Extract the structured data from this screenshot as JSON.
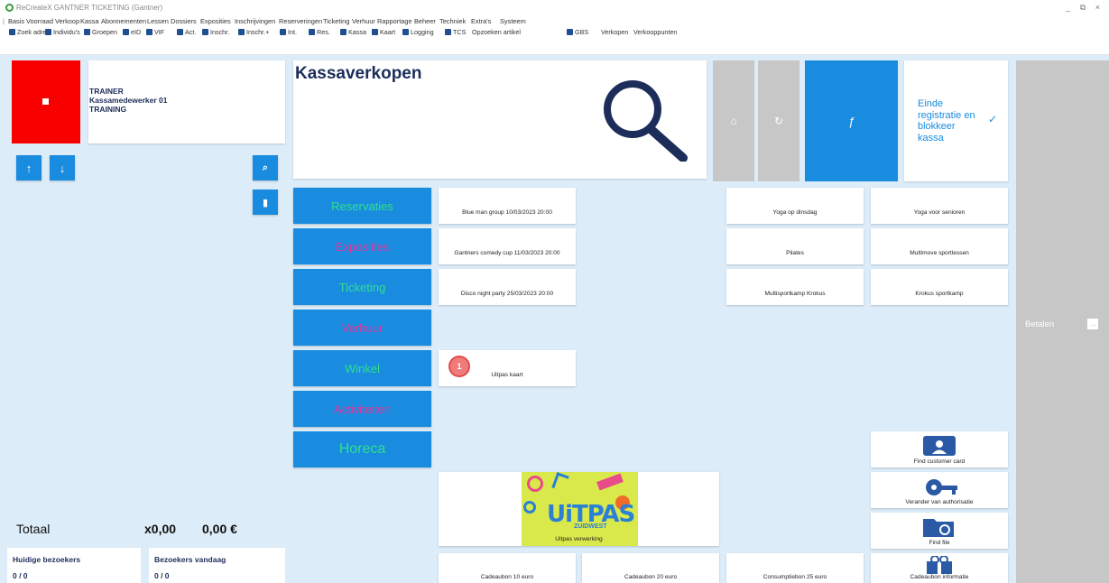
{
  "window": {
    "title": "ReCreateX GANTNER TICKETING (Gantner)",
    "controls": "_ ⧉ ×"
  },
  "menu": [
    "Basis",
    "Voorraad",
    "Verkoop",
    "Kassa",
    "Abonnementen",
    "Lessen",
    "Dossiers",
    "Exposities",
    "Inschrijvingen",
    "Reserveringen",
    "Ticketing",
    "Verhuur",
    "Rapportage",
    "Beheer",
    "Techniek",
    "Extra's",
    "Systeem"
  ],
  "toolbar": [
    "Zoek adres",
    "Individu's",
    "Groepen",
    "eID",
    "VIF",
    "Act.",
    "Inschr.",
    "Inschr.+",
    "Int.",
    "Res.",
    "Kassa",
    "Kaart",
    "Logging",
    "TCS",
    "Opzoeken artikel",
    "GBS",
    "Verkopen",
    "Verkooppunten"
  ],
  "user": {
    "line1": "TRAINER",
    "line2": "Kassamedewerker 01",
    "line3": "TRAINING"
  },
  "totals": {
    "label": "Totaal",
    "quantity": "x0,00",
    "amount": "0,00 €"
  },
  "visitors": {
    "current_label": "Huidige bezoekers",
    "current_value": "0 / 0",
    "today_label": "Bezoekers vandaag",
    "today_value": "0 / 0"
  },
  "header": {
    "title": "Kassaverkopen"
  },
  "end_registration": "Einde registratie en blokkeer kassa",
  "pay_label": "Betalen",
  "categories": [
    {
      "label": "Reservaties",
      "color": "#2ee08a"
    },
    {
      "label": "Exposities",
      "color": "#e0369a"
    },
    {
      "label": "Ticketing",
      "color": "#2ee08a"
    },
    {
      "label": "Verhuur",
      "color": "#e0369a"
    },
    {
      "label": "Winkel",
      "color": "#2ee08a"
    },
    {
      "label": "Activiteiten",
      "color": "#e0369a"
    },
    {
      "label": "Horeca",
      "color": "#2ee08a"
    }
  ],
  "products": {
    "p1": "Blue man group 10/03/2023 20:00",
    "p2": "Gantners comedy cup 11/03/2023 20:00",
    "p3": "Disco night party 25/03/2023 20:00",
    "p4": "Uitpas kaart",
    "p4_badge": "1",
    "p5": "Yoga op dinsdag",
    "p6": "Yoga voor senioren",
    "p7": "Pilates",
    "p8": "Multimove sportlessen",
    "p9": "Multisportkamp Krokus",
    "p10": "Krokus sportkamp",
    "uitpas_processing": "Uitpas verwerking",
    "uitpas_logo_main": "UiTPAS",
    "uitpas_logo_sub": "ZUIDWEST",
    "v1": "Cadeaubon 10 euro",
    "v2": "Cadeaubon 20  euro",
    "v3": "Consumptiebon 25 euro"
  },
  "actions": {
    "find_card": "Find customer card",
    "change_auth": "Verander van authorisatie",
    "find_file": "Find file",
    "voucher_info": "Cadeaubon informatie"
  }
}
